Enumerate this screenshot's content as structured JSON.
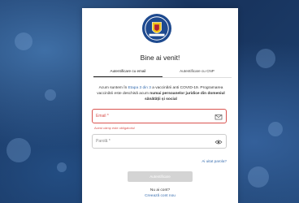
{
  "page": {
    "title": "Bine ai venit!",
    "tabs": [
      "Autentificare cu email",
      "Autentificare cu CNP"
    ],
    "info": {
      "before": "Acum suntem în ",
      "stage": "Etapa 3 din 3",
      "middle": " a vaccinării anti COVID-19. Programarea vaccinării este deschisă acum ",
      "bold": "numai persoanelor juridice din domeniul sănătății și social"
    },
    "email": {
      "placeholder": "Email *",
      "error": "Acest câmp este obligatoriu!"
    },
    "password": {
      "placeholder": "Parolă *"
    },
    "forgot": "Ai uitat parola?",
    "submit": "Autentificare",
    "no_account": "Nu ai cont?",
    "create_account": "Creează cont nou"
  },
  "colors": {
    "accent": "#3a6fb0",
    "error": "#d9534f",
    "background": "#1b3b66"
  },
  "icons": {
    "email": "envelope-icon",
    "password": "eye-icon",
    "logo": "romania-coat-of-arms"
  }
}
